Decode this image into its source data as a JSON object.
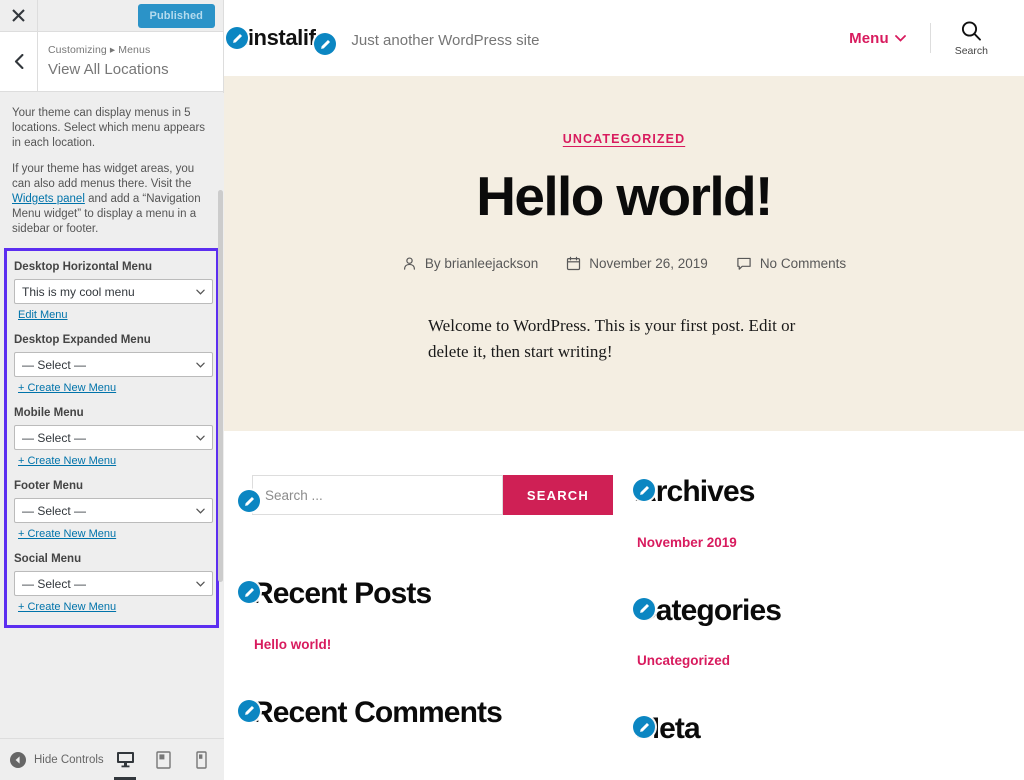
{
  "customizer": {
    "close_label": "Close",
    "publish_label": "Published",
    "back_label": "Back",
    "breadcrumb": "Customizing ▸ Menus",
    "panel_title": "View All Locations",
    "description": [
      "Your theme can display menus in 5 locations. Select which menu appears in each location.",
      "If your theme has widget areas, you can also add menus there. Visit the Widgets panel and add a “Navigation Menu widget” to display a menu in a sidebar or footer."
    ],
    "widgets_panel_link": "Widgets panel",
    "locations": [
      {
        "label": "Desktop Horizontal Menu",
        "value": "This is my cool menu",
        "link": "Edit Menu"
      },
      {
        "label": "Desktop Expanded Menu",
        "value": "— Select —",
        "link": "+ Create New Menu"
      },
      {
        "label": "Mobile Menu",
        "value": "— Select —",
        "link": "+ Create New Menu"
      },
      {
        "label": "Footer Menu",
        "value": "— Select —",
        "link": "+ Create New Menu"
      },
      {
        "label": "Social Menu",
        "value": "— Select —",
        "link": "+ Create New Menu"
      }
    ],
    "footer": {
      "hide_controls": "Hide Controls",
      "devices": [
        "desktop",
        "tablet",
        "mobile"
      ],
      "active_device": "desktop"
    },
    "highlight_color": "#5c2ef0"
  },
  "preview": {
    "site_title": "kinstalife",
    "tagline": "Just another WordPress site",
    "menu_label": "Menu",
    "search_label": "Search",
    "post": {
      "category": "UNCATEGORIZED",
      "title": "Hello world!",
      "author": "By brianleejackson",
      "date": "November 26, 2019",
      "comments": "No Comments",
      "body": "Welcome to WordPress. This is your first post. Edit or delete it, then start writing!"
    },
    "search_widget": {
      "placeholder": "Search ...",
      "button": "SEARCH"
    },
    "widgets_left": [
      {
        "title": "Recent Posts",
        "items": [
          "Hello world!"
        ]
      },
      {
        "title": "Recent Comments",
        "items": []
      }
    ],
    "widgets_right": [
      {
        "title": "Archives",
        "items": [
          "November 2019"
        ]
      },
      {
        "title": "Categories",
        "items": [
          "Uncategorized"
        ]
      },
      {
        "title": "Meta",
        "items": []
      }
    ],
    "accent_color": "#d81b5e",
    "hero_bg": "#f4eee2"
  }
}
